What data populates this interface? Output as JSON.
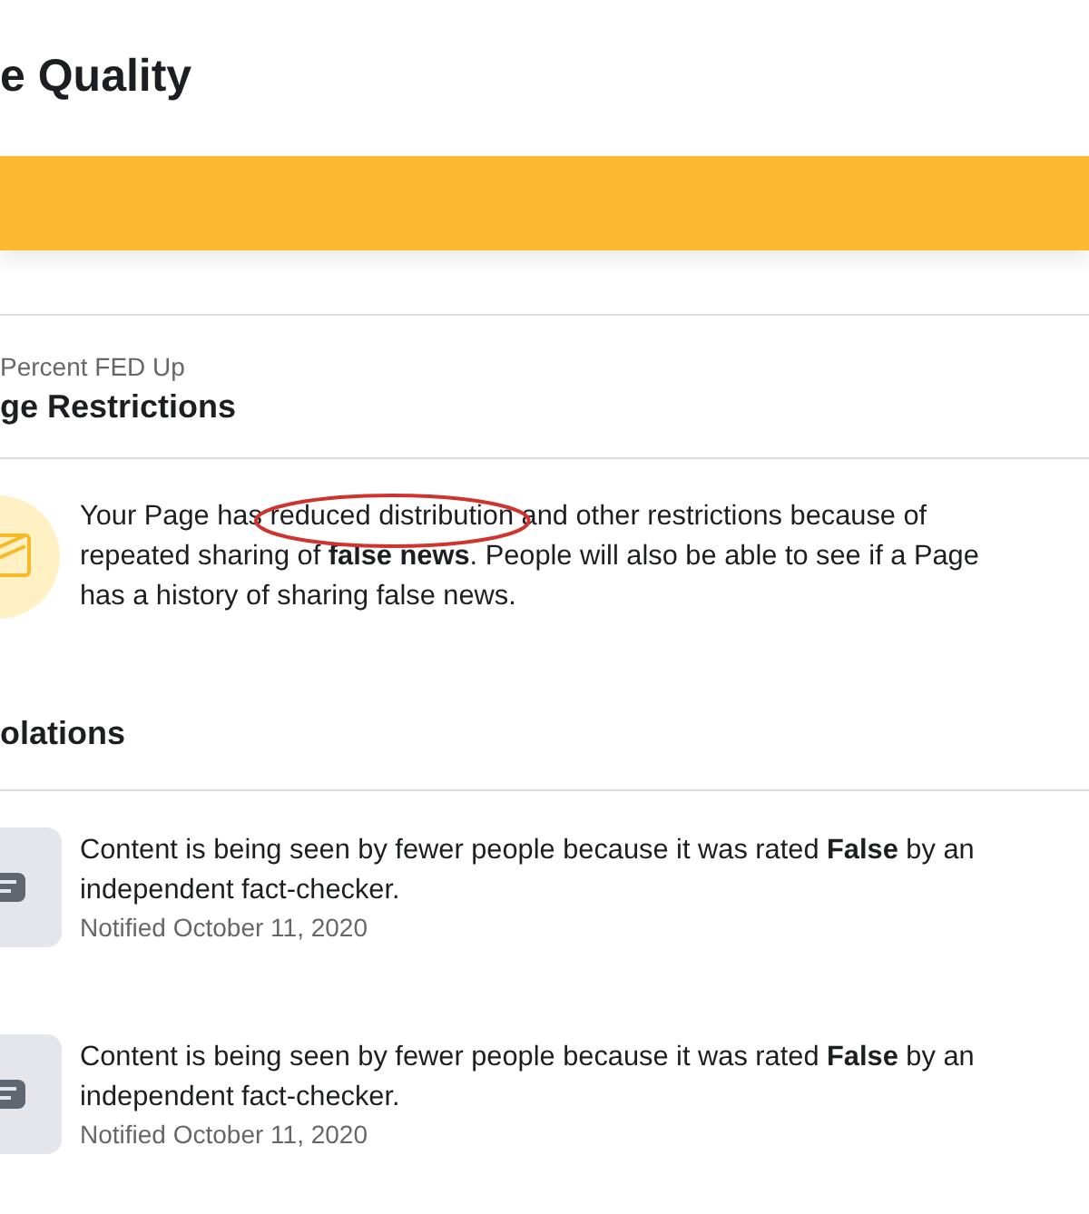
{
  "page_title": "e Quality",
  "banner": {
    "color": "#fbb830"
  },
  "restrictions": {
    "page_name": "Percent FED Up",
    "heading": "ge Restrictions",
    "description": {
      "before": "Your Page has ",
      "circled": "reduced distribution",
      "after": " and other restrictions because of repeated sharing of **false news**. People will also be able to see if a Page has a history of sharing false news."
    }
  },
  "violations": {
    "heading": "olations",
    "items": [
      {
        "message": "Content is being seen by fewer people because it was rated **False** by an independent fact-checker.",
        "notified": "Notified October 11, 2020"
      },
      {
        "message": "Content is being seen by fewer people because it was rated **False** by an independent fact-checker.",
        "notified": "Notified October 11, 2020"
      }
    ]
  }
}
